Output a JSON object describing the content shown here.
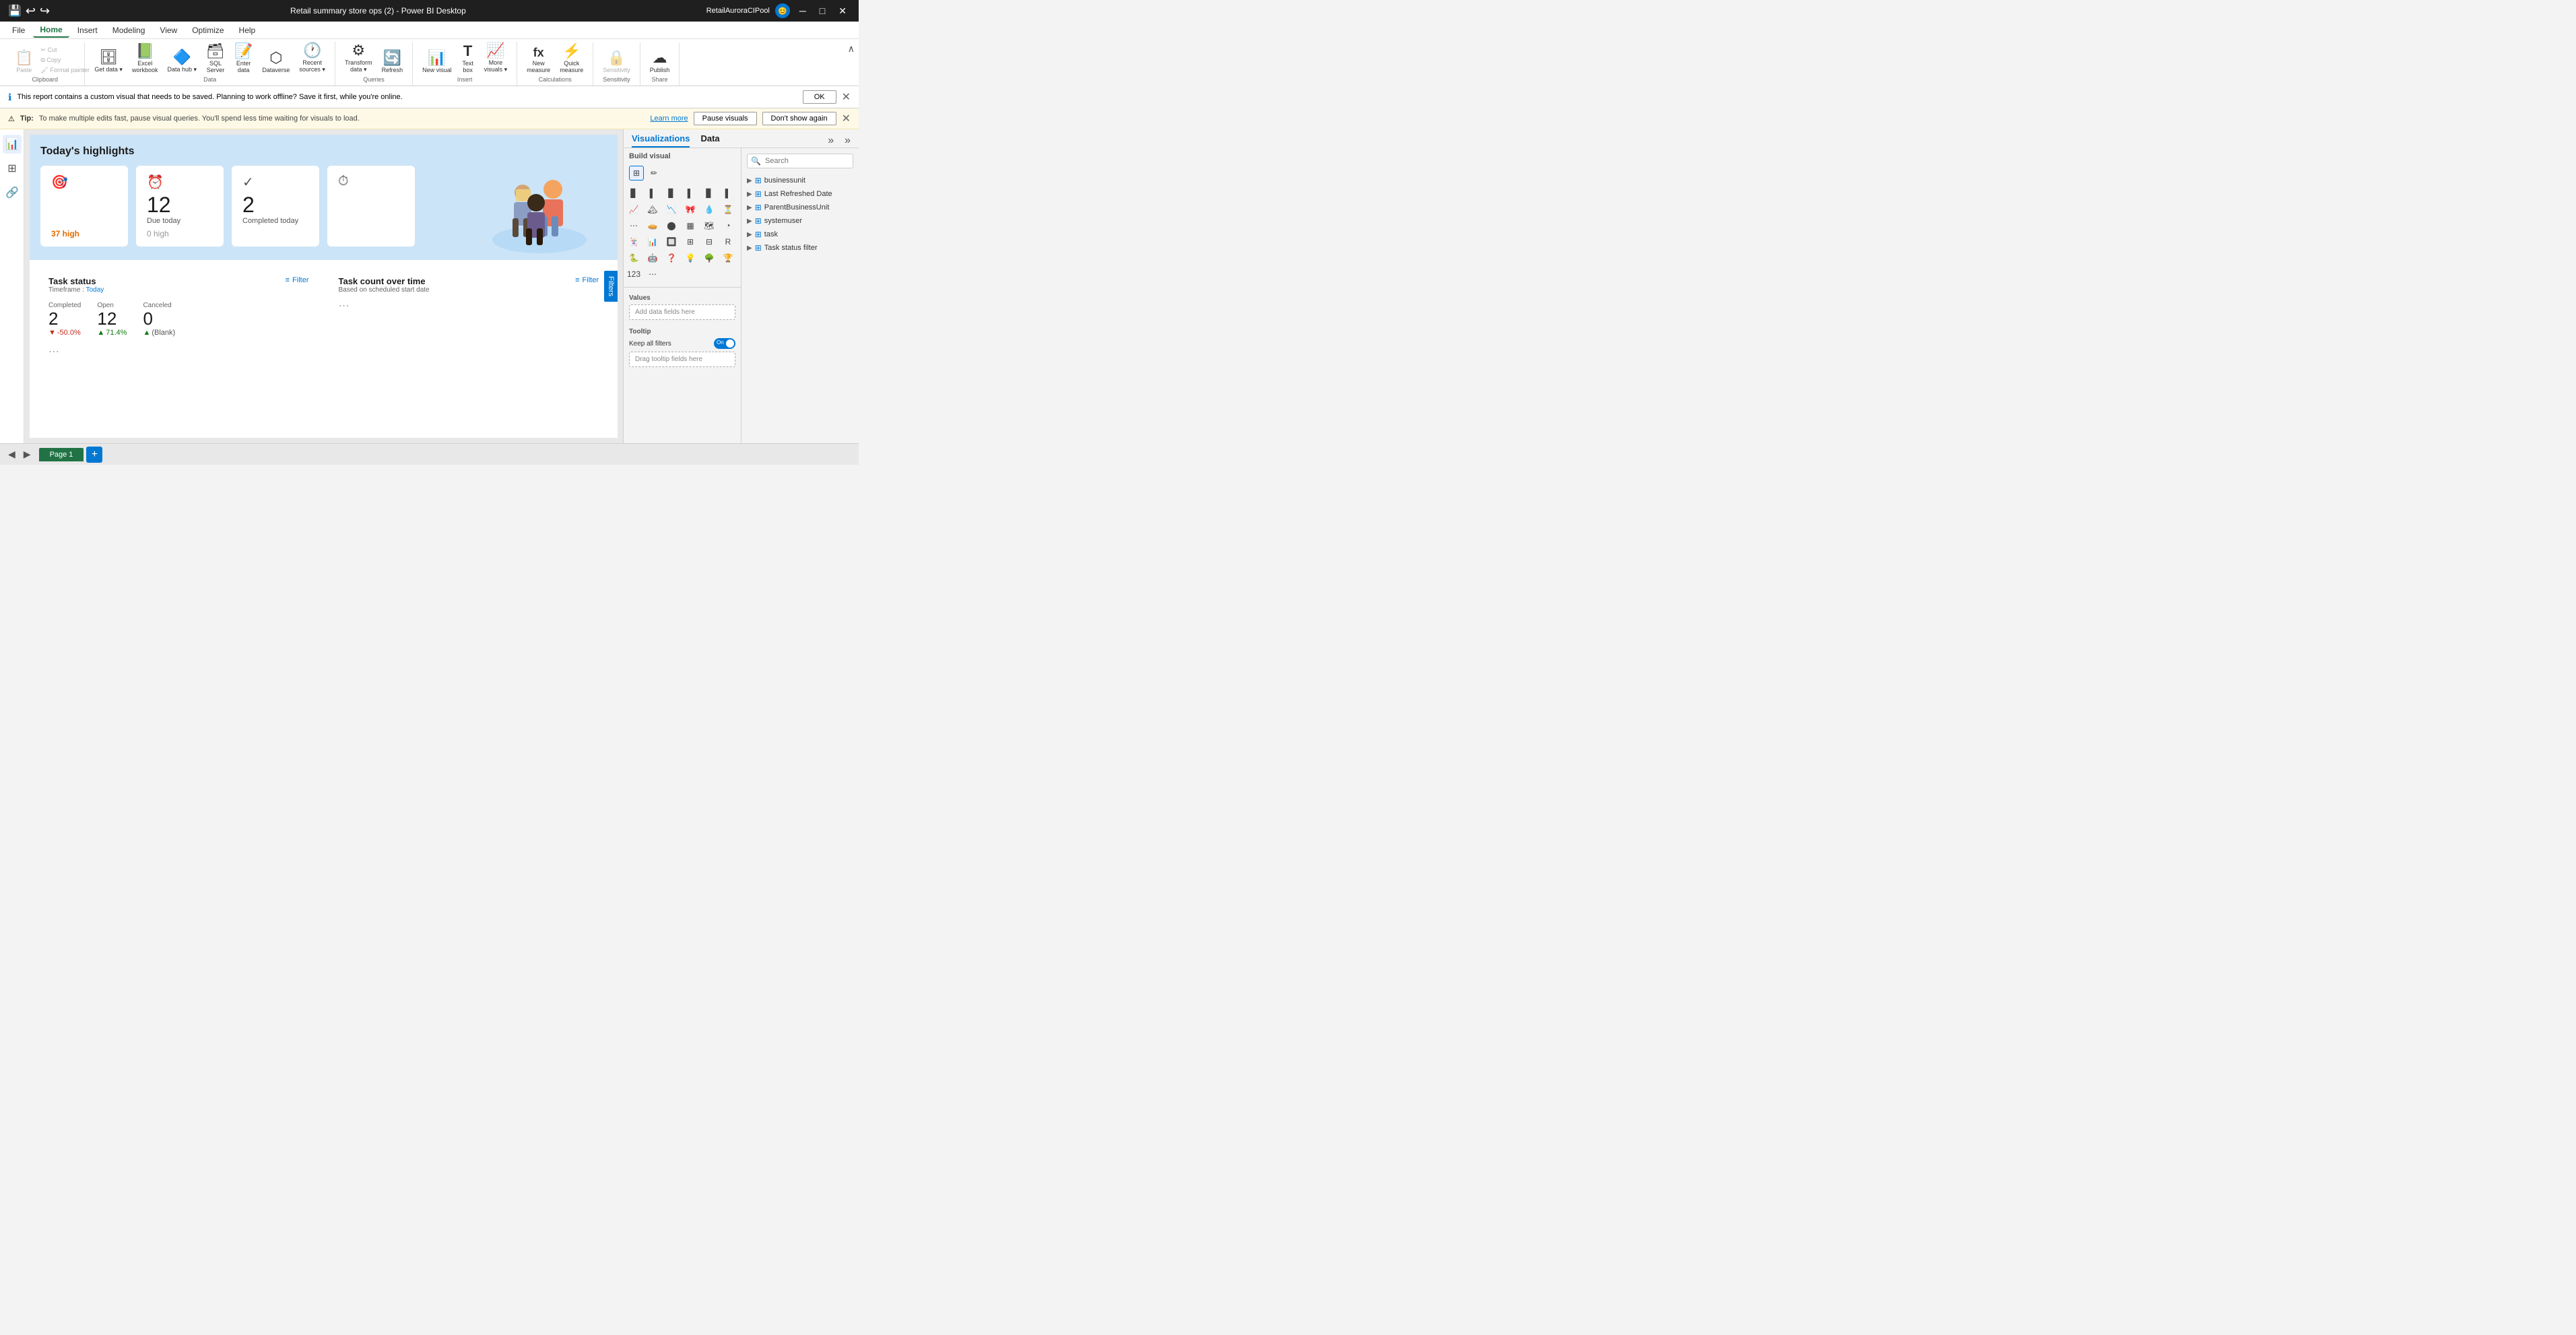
{
  "titlebar": {
    "title": "Retail summary store ops (2) - Power BI Desktop",
    "user": "RetailAuroraCIPool",
    "minimize": "─",
    "maximize": "□",
    "close": "✕"
  },
  "menubar": {
    "items": [
      "File",
      "Home",
      "Insert",
      "Modeling",
      "View",
      "Optimize",
      "Help"
    ],
    "active": "Home"
  },
  "ribbon": {
    "groups": [
      {
        "label": "Clipboard",
        "items": [
          {
            "id": "paste",
            "icon": "📋",
            "label": "Paste",
            "large": true
          },
          {
            "id": "cut",
            "icon": "✂",
            "label": "Cut"
          },
          {
            "id": "copy",
            "icon": "⧉",
            "label": "Copy"
          },
          {
            "id": "format-painter",
            "icon": "🖌",
            "label": "Format painter"
          }
        ]
      },
      {
        "label": "Data",
        "items": [
          {
            "id": "get-data",
            "icon": "🗄",
            "label": "Get data ▾"
          },
          {
            "id": "excel-workbook",
            "icon": "📗",
            "label": "Excel workbook"
          },
          {
            "id": "data-hub",
            "icon": "🔷",
            "label": "Data hub ▾"
          },
          {
            "id": "sql-server",
            "icon": "🗃",
            "label": "SQL Server"
          },
          {
            "id": "enter-data",
            "icon": "📝",
            "label": "Enter data"
          },
          {
            "id": "dataverse",
            "icon": "⬡",
            "label": "Dataverse"
          },
          {
            "id": "recent-sources",
            "icon": "🕐",
            "label": "Recent sources ▾"
          }
        ]
      },
      {
        "label": "Queries",
        "items": [
          {
            "id": "transform-data",
            "icon": "⚙",
            "label": "Transform data ▾"
          },
          {
            "id": "refresh",
            "icon": "🔄",
            "label": "Refresh"
          }
        ]
      },
      {
        "label": "Insert",
        "items": [
          {
            "id": "new-visual",
            "icon": "📊",
            "label": "New visual"
          },
          {
            "id": "text-box",
            "icon": "T",
            "label": "Text box"
          },
          {
            "id": "more-visuals",
            "icon": "📈",
            "label": "More visuals ▾"
          }
        ]
      },
      {
        "label": "Calculations",
        "items": [
          {
            "id": "new-measure",
            "icon": "fx",
            "label": "New measure"
          },
          {
            "id": "quick-measure",
            "icon": "⚡",
            "label": "Quick measure"
          }
        ]
      },
      {
        "label": "Sensitivity",
        "items": [
          {
            "id": "sensitivity",
            "icon": "🔒",
            "label": "Sensitivity"
          }
        ]
      },
      {
        "label": "Share",
        "items": [
          {
            "id": "publish",
            "icon": "☁",
            "label": "Publish"
          }
        ]
      }
    ]
  },
  "notification": {
    "message": "This report contains a custom visual that needs to be saved. Planning to work offline? Save it first, while you're online.",
    "ok_label": "OK",
    "info_icon": "ℹ"
  },
  "tip": {
    "tip_label": "Tip:",
    "message": "To make multiple edits fast, pause visual queries. You'll spend less time waiting for visuals to load.",
    "learn_more": "Learn more",
    "pause_label": "Pause visuals",
    "dont_show_label": "Don't show again",
    "warn_icon": "⚠"
  },
  "canvas": {
    "filter_tab": "Filters",
    "highlights": {
      "title": "Today's highlights",
      "cards": [
        {
          "icon": "🎯",
          "value": "",
          "label": "",
          "badge": "37 high",
          "badge_class": "badge-high"
        },
        {
          "icon": "⏰",
          "value": "12",
          "label": "Due today",
          "badge": "0 high",
          "badge_class": "badge-zero"
        },
        {
          "icon": "✓",
          "value": "2",
          "label": "Completed today",
          "badge": "",
          "badge_class": ""
        },
        {
          "icon": "⏱",
          "value": "",
          "label": "",
          "badge": "",
          "badge_class": ""
        }
      ]
    },
    "task_status": {
      "title": "Task status",
      "subtitle_prefix": "Timeframe : ",
      "subtitle_link": "Today",
      "filter_label": "Filter",
      "metrics": [
        {
          "label": "Completed",
          "value": "2",
          "change": "-50.0%",
          "change_class": "change-down",
          "change_icon": "▼"
        },
        {
          "label": "Open",
          "value": "12",
          "change": "71.4%",
          "change_class": "change-up",
          "change_icon": "▲"
        },
        {
          "label": "Canceled",
          "value": "0",
          "change": "(Blank)",
          "change_icon": "▲",
          "change_class": "metric-blank"
        }
      ]
    },
    "task_count": {
      "title": "Task count over time",
      "subtitle": "Based on scheduled start date",
      "filter_label": "Filter"
    }
  },
  "visualizations": {
    "panel_title": "Visualizations",
    "data_title": "Data",
    "build_visual_label": "Build visual",
    "values_label": "Values",
    "values_placeholder": "Add data fields here",
    "tooltip_label": "Tooltip",
    "keep_filters_label": "Keep all filters",
    "keep_filters_toggle": "On",
    "drag_tooltip_placeholder": "Drag tooltip fields here",
    "search_placeholder": "Search",
    "data_items": [
      {
        "label": "businessunit",
        "icon": "⊞",
        "expanded": false
      },
      {
        "label": "Last Refreshed Date",
        "icon": "⊞",
        "expanded": false
      },
      {
        "label": "ParentBusinessUnit",
        "icon": "⊞",
        "expanded": false
      },
      {
        "label": "systemuser",
        "icon": "⊞",
        "expanded": false
      },
      {
        "label": "task",
        "icon": "⊞",
        "expanded": false
      },
      {
        "label": "Task status filter",
        "icon": "⊞",
        "expanded": false
      }
    ]
  },
  "pages": {
    "current": "Page 1",
    "add_icon": "+"
  }
}
